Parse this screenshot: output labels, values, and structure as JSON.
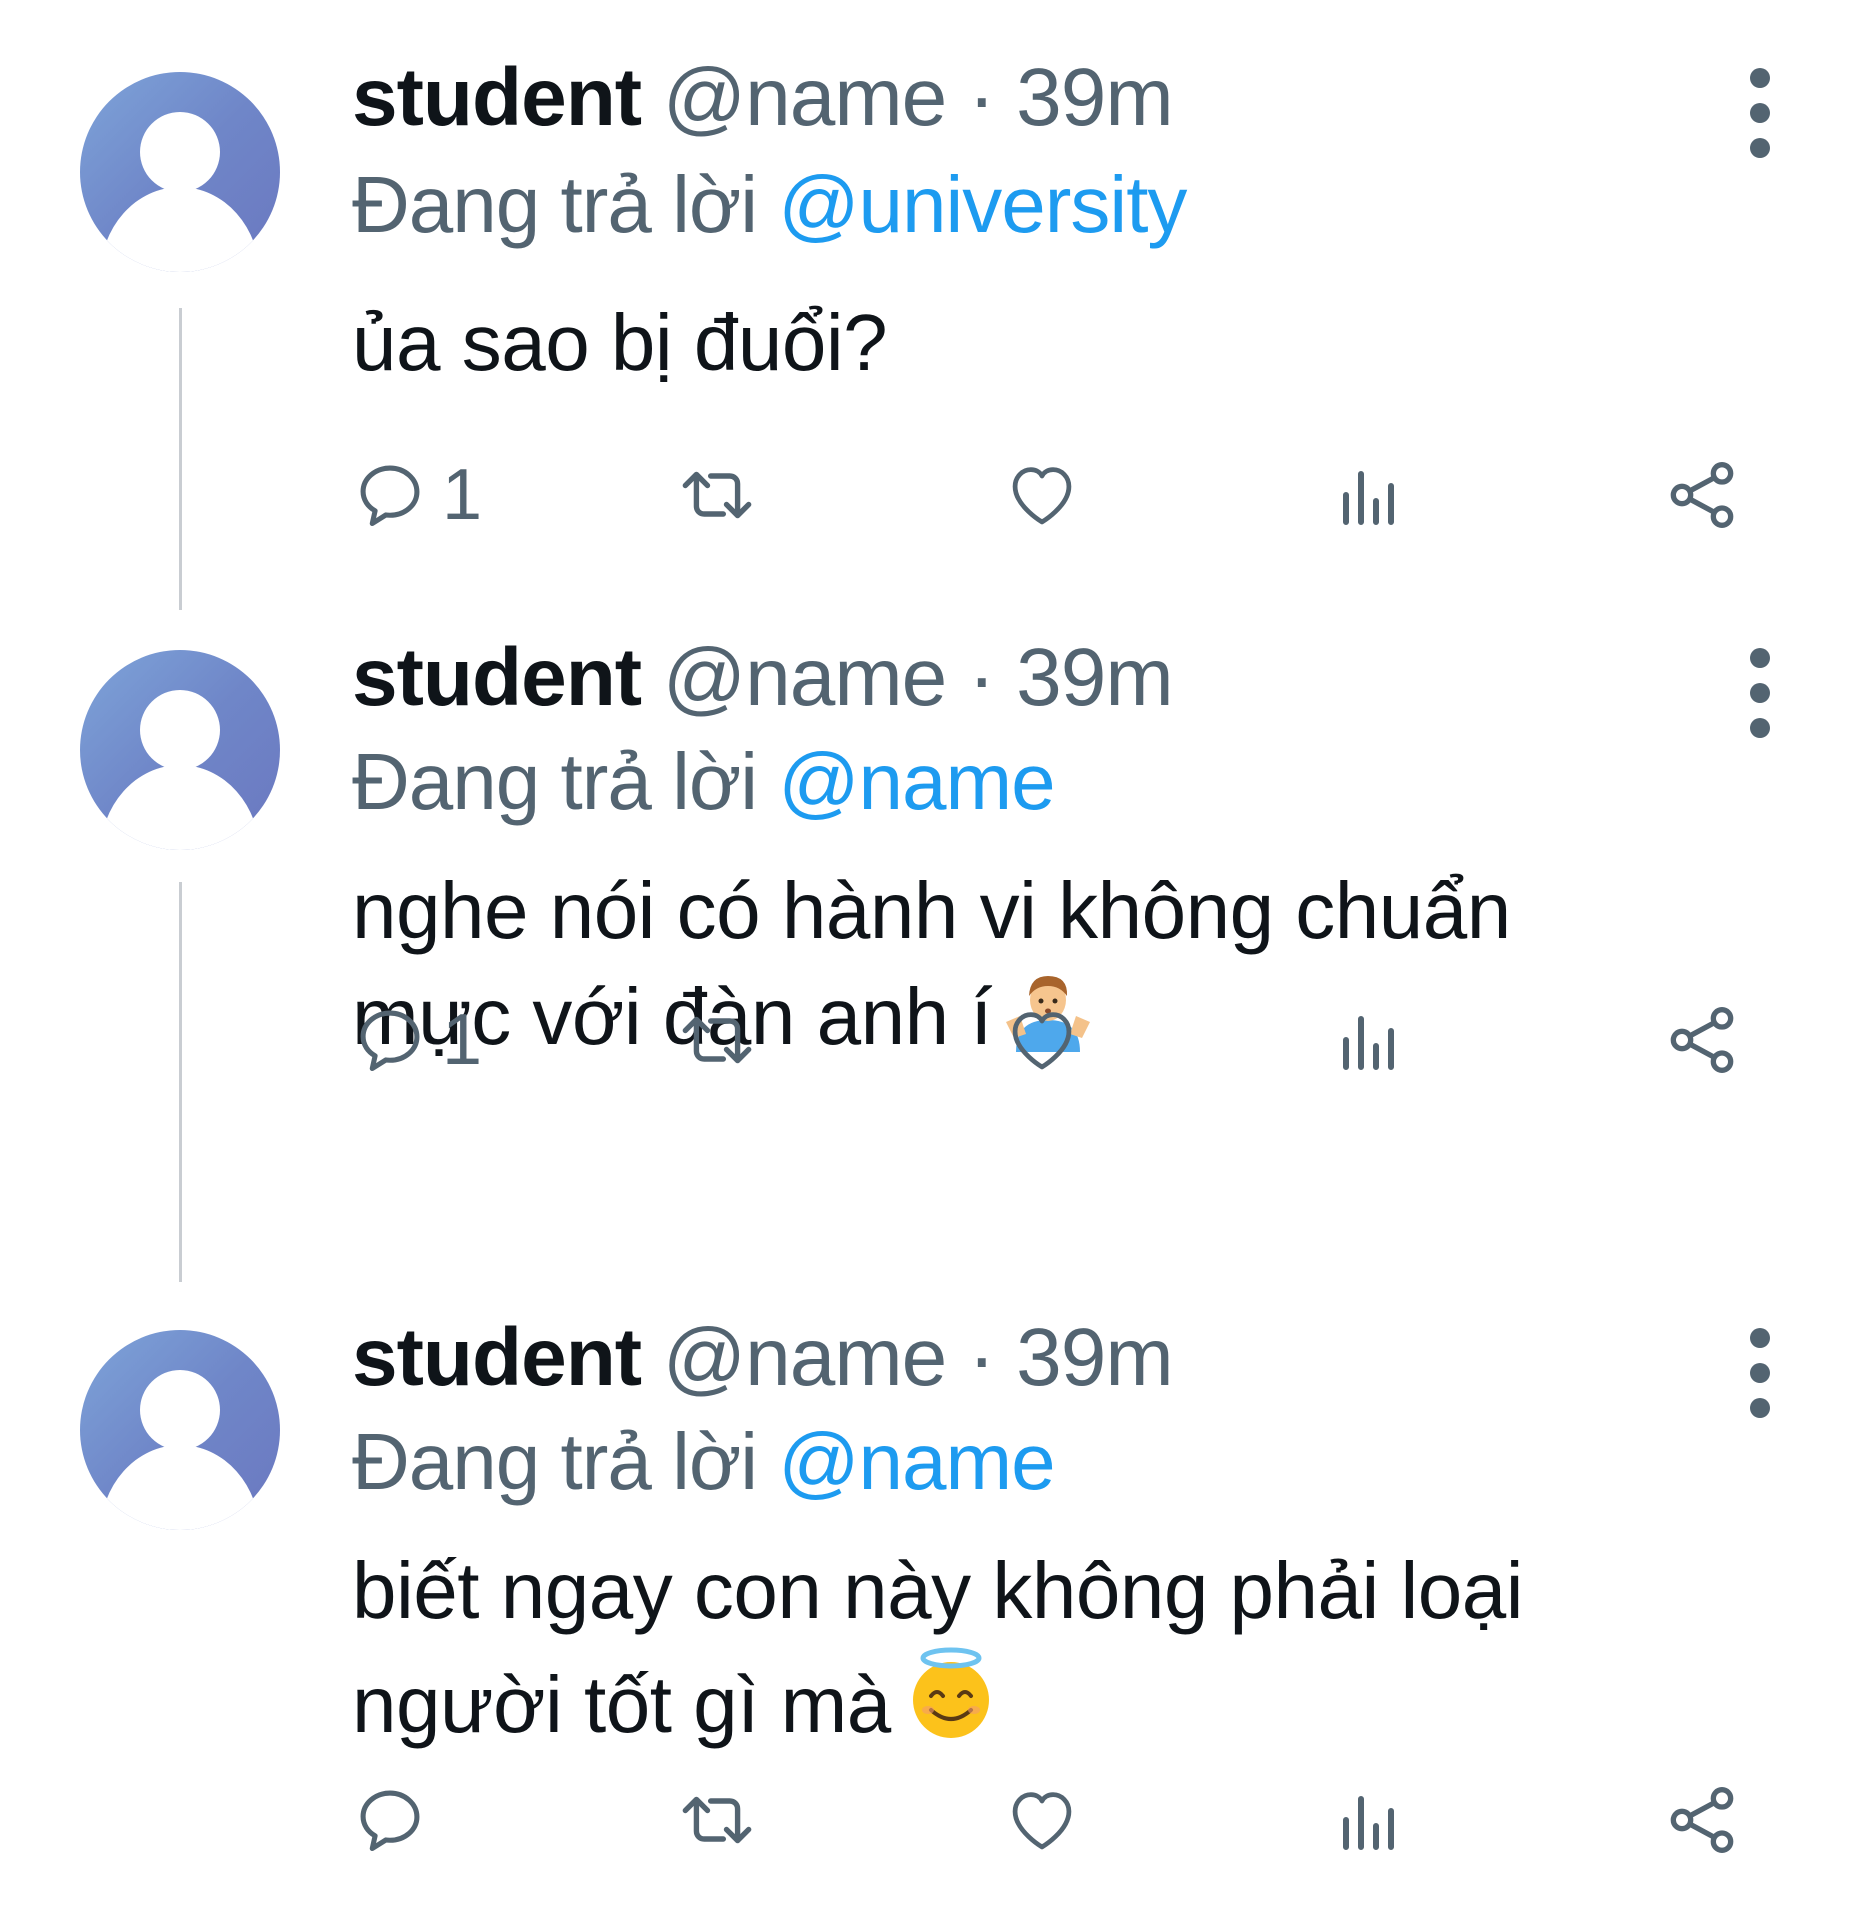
{
  "tweets": [
    {
      "display_name": "student",
      "handle": "@name",
      "separator": "·",
      "time": "39m",
      "reply_prefix": "Đang trả lời",
      "reply_to": "@university",
      "text_lines": [
        "ủa sao bị đuổi?"
      ],
      "emoji": "",
      "reply_count": "1"
    },
    {
      "display_name": "student",
      "handle": "@name",
      "separator": "·",
      "time": "39m",
      "reply_prefix": "Đang trả lời",
      "reply_to": "@name",
      "text_lines": [
        "nghe nói có hành vi không chuẩn",
        "mực với đàn anh í"
      ],
      "emoji": "person-shrugging",
      "reply_count": "1"
    },
    {
      "display_name": "student",
      "handle": "@name",
      "separator": "·",
      "time": "39m",
      "reply_prefix": "Đang trả lời",
      "reply_to": "@name",
      "text_lines": [
        "biết ngay con này không phải loại",
        "người tốt gì mà"
      ],
      "emoji": "smiling-face-with-halo",
      "reply_count": ""
    }
  ],
  "icons": {
    "reply": "reply-icon",
    "retweet": "retweet-icon",
    "like": "heart-icon",
    "views": "views-icon",
    "share": "share-icon",
    "more": "more-vertical-icon",
    "avatar": "default-avatar-icon"
  },
  "colors": {
    "text": "#0f1419",
    "secondary": "#536471",
    "mention": "#1d9bf0",
    "thread_line": "#c9cdd2",
    "avatar_gradient_start": "#7ea4d9",
    "avatar_gradient_end": "#6b78c0"
  }
}
